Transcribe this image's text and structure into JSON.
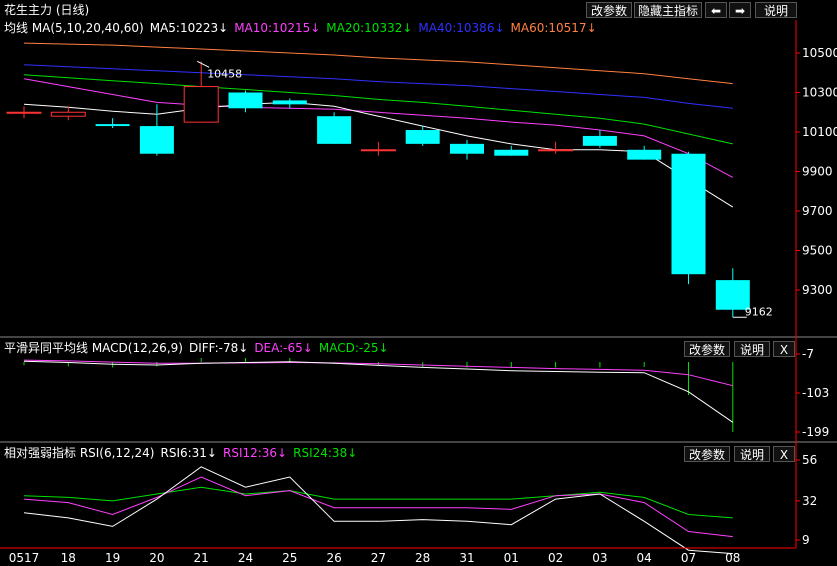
{
  "title": "花生主力 (日线)",
  "toolbar": {
    "params": "改参数",
    "hide_main": "隐藏主指标",
    "left_arrow": "⬅",
    "right_arrow": "➡",
    "help": "说明"
  },
  "colors": {
    "bg": "#000000",
    "up": "#ff3232",
    "down": "#00ffff",
    "ma5": "#ffffff",
    "ma10": "#ff40ff",
    "ma20": "#00e000",
    "ma40": "#3030ff",
    "ma60": "#ff8040",
    "axis": "#ff0000"
  },
  "main": {
    "legend": [
      {
        "text": "均线 MA(5,10,20,40,60)",
        "color": "#ffffff"
      },
      {
        "text": "MA5:10223↓",
        "color": "#ffffff"
      },
      {
        "text": "MA10:10215↓",
        "color": "#ff40ff"
      },
      {
        "text": "MA20:10332↓",
        "color": "#00e000"
      },
      {
        "text": "MA40:10386↓",
        "color": "#3030ff"
      },
      {
        "text": "MA60:10517↓",
        "color": "#ff8040"
      }
    ],
    "y_ticks": [
      "10500",
      "10300",
      "10100",
      "9900",
      "9700",
      "9500",
      "9300"
    ],
    "y_tick_values": [
      10500,
      10300,
      10100,
      9900,
      9700,
      9500,
      9300
    ],
    "high_label": "10458",
    "low_label": "9162"
  },
  "macd": {
    "legend": [
      {
        "text": "平滑异同平均线 MACD(12,26,9)",
        "color": "#ffffff"
      },
      {
        "text": "DIFF:-78↓",
        "color": "#ffffff"
      },
      {
        "text": "DEA:-65↓",
        "color": "#ff40ff"
      },
      {
        "text": "MACD:-25↓",
        "color": "#00e000"
      }
    ],
    "y_ticks": [
      "-7",
      "-103",
      "-199"
    ],
    "params": "改参数",
    "help": "说明",
    "close": "X"
  },
  "rsi": {
    "legend": [
      {
        "text": "相对强弱指标 RSI(6,12,24)",
        "color": "#ffffff"
      },
      {
        "text": "RSI6:31↓",
        "color": "#ffffff"
      },
      {
        "text": "RSI12:36↓",
        "color": "#ff40ff"
      },
      {
        "text": "RSI24:38↓",
        "color": "#00e000"
      }
    ],
    "y_ticks": [
      "56",
      "32",
      "9"
    ],
    "params": "改参数",
    "help": "说明",
    "close": "X"
  },
  "chart_data": {
    "type": "candlestick",
    "categories": [
      "0517",
      "18",
      "19",
      "20",
      "21",
      "24",
      "25",
      "26",
      "27",
      "28",
      "31",
      "01",
      "02",
      "03",
      "04",
      "07",
      "08"
    ],
    "ohlc": [
      [
        10200,
        10230,
        10170,
        10200
      ],
      [
        10180,
        10230,
        10160,
        10200
      ],
      [
        10140,
        10170,
        10120,
        10130
      ],
      [
        10130,
        10240,
        9980,
        9990
      ],
      [
        10150,
        10458,
        10150,
        10330
      ],
      [
        10300,
        10310,
        10200,
        10220
      ],
      [
        10260,
        10270,
        10220,
        10240
      ],
      [
        10180,
        10200,
        10040,
        10040
      ],
      [
        10010,
        10050,
        9980,
        10010
      ],
      [
        10110,
        10130,
        10030,
        10040
      ],
      [
        10040,
        10060,
        9960,
        9990
      ],
      [
        10010,
        10030,
        9980,
        9980
      ],
      [
        10010,
        10050,
        9990,
        10010
      ],
      [
        10080,
        10110,
        10020,
        10030
      ],
      [
        10010,
        10030,
        9960,
        9960
      ],
      [
        9990,
        10000,
        9330,
        9380
      ],
      [
        9350,
        9410,
        9162,
        9200
      ]
    ],
    "ma5": [
      10240,
      10225,
      10205,
      10190,
      10220,
      10240,
      10250,
      10230,
      10180,
      10130,
      10080,
      10040,
      10010,
      10010,
      10000,
      9860,
      9720
    ],
    "ma10": [
      10370,
      10330,
      10290,
      10250,
      10235,
      10225,
      10220,
      10215,
      10200,
      10185,
      10170,
      10150,
      10135,
      10110,
      10080,
      9990,
      9870
    ],
    "ma20": [
      10390,
      10375,
      10360,
      10345,
      10330,
      10315,
      10300,
      10285,
      10265,
      10250,
      10230,
      10210,
      10190,
      10170,
      10140,
      10090,
      10040
    ],
    "ma40": [
      10440,
      10430,
      10420,
      10410,
      10400,
      10390,
      10380,
      10370,
      10355,
      10345,
      10335,
      10320,
      10305,
      10290,
      10275,
      10245,
      10220
    ],
    "ma60": [
      10550,
      10545,
      10540,
      10530,
      10520,
      10510,
      10500,
      10490,
      10475,
      10465,
      10455,
      10440,
      10425,
      10410,
      10395,
      10370,
      10345
    ],
    "macd_diff": [
      -25,
      -28,
      -32,
      -34,
      -30,
      -28,
      -26,
      -30,
      -35,
      -40,
      -44,
      -48,
      -50,
      -52,
      -53,
      -100,
      -175
    ],
    "macd_dea": [
      -22,
      -24,
      -27,
      -30,
      -30,
      -29,
      -28,
      -29,
      -31,
      -34,
      -37,
      -40,
      -43,
      -45,
      -47,
      -58,
      -85
    ],
    "macd_hist": [
      -6,
      -8,
      -10,
      -8,
      0,
      2,
      4,
      -1,
      -6,
      -9,
      -10,
      -11,
      -10,
      -10,
      -9,
      -60,
      -130
    ],
    "rsi6": [
      25,
      22,
      17,
      33,
      52,
      40,
      46,
      20,
      20,
      21,
      20,
      18,
      33,
      36,
      20,
      3,
      1
    ],
    "rsi12": [
      33,
      31,
      24,
      34,
      46,
      35,
      38,
      28,
      28,
      28,
      28,
      27,
      35,
      36,
      31,
      14,
      11
    ],
    "rsi24": [
      35,
      34,
      32,
      36,
      40,
      36,
      38,
      33,
      33,
      33,
      33,
      33,
      35,
      37,
      34,
      24,
      22
    ]
  }
}
